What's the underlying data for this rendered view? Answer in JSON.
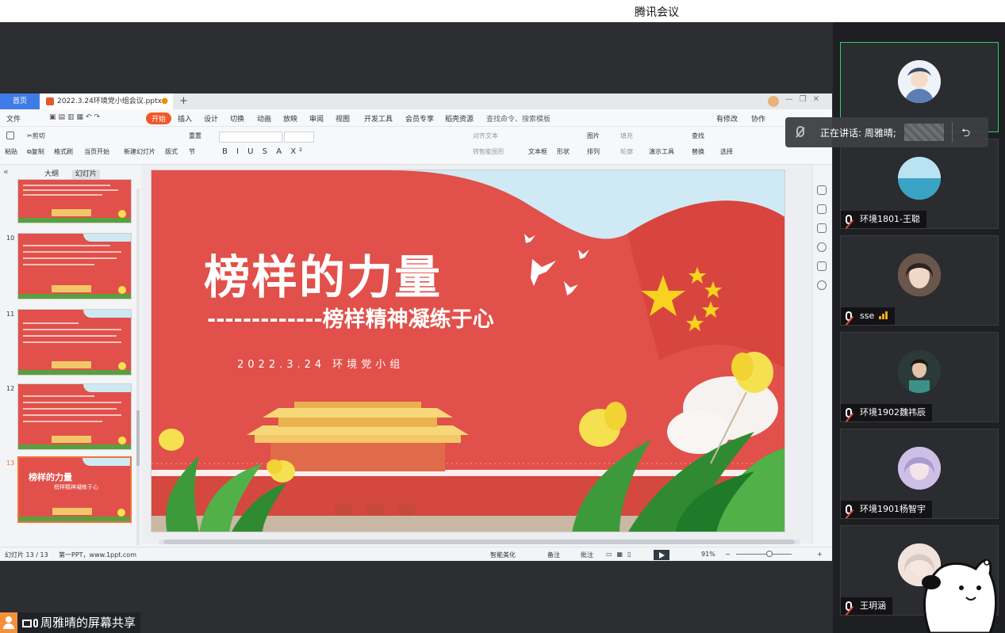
{
  "app_title": "腾讯会议",
  "wps": {
    "home_tab": "首页",
    "doc_tab": "2022.3.24环境党小组会议.pptx",
    "menu": {
      "file": "文件",
      "start": "开始",
      "items": [
        "插入",
        "设计",
        "切换",
        "动画",
        "放映",
        "审阅",
        "视图",
        "开发工具",
        "会员专享",
        "稻壳资源"
      ],
      "search": "查找命令、搜索模板",
      "right": [
        "有修改",
        "协作"
      ]
    },
    "ribbon": {
      "paste": "粘贴",
      "cut": "剪切",
      "copy": "复制",
      "format_painter": "格式刷",
      "from_current": "当页开始",
      "new_slide": "新建幻灯片",
      "layout": "版式",
      "section": "节",
      "reset": "重置",
      "text_direction": "对齐文本",
      "smart_art": "转智能图形",
      "textbox": "文本框",
      "shape": "形状",
      "picture": "图片",
      "arrange": "排列",
      "fill": "填充",
      "outline": "轮廓",
      "tools": "演示工具",
      "find": "查找",
      "replace": "替换",
      "select": "选择"
    },
    "leftpane": {
      "tab_outline": "大纲",
      "tab_slides": "幻灯片",
      "slide_numbers": [
        "10",
        "11",
        "12",
        "13"
      ],
      "thumb_title": "榜样的力量",
      "thumb_sub": "榜样精神凝练于心"
    },
    "slide": {
      "title": "榜样的力量",
      "subtitle": "-------------榜样精神凝练于心",
      "date_line": "2022.3.24  环境党小组"
    },
    "status": {
      "slide_count": "幻灯片 13 / 13",
      "template": "第一PPT，www.1ppt.com",
      "smart": "智能美化",
      "notes": "备注",
      "comment": "批注",
      "zoom": "91%"
    }
  },
  "speaking_toast": {
    "text": "正在讲话: 周雅晴;"
  },
  "participants": [
    {
      "name": "",
      "speaking": true,
      "avatar_color": "#dfe9f5"
    },
    {
      "name": "环境1801-王聪",
      "avatar_color": "#7cc4dd"
    },
    {
      "name": "sse",
      "avatar_color": "#c9a58c",
      "signal": true
    },
    {
      "name": "环境1902魏祎辰",
      "avatar_color": "#3b4a44"
    },
    {
      "name": "环境1901杨智宇",
      "avatar_color": "#b9a7d6"
    },
    {
      "name": "王玥涵",
      "avatar_color": "#e9d5c8"
    }
  ],
  "share_label": "周雅晴的屏幕共享",
  "colors": {
    "slide_red": "#e1504a",
    "accent_orange": "#f0582a",
    "speaking_green": "#2fd06a",
    "star_yellow": "#f7d21e"
  }
}
